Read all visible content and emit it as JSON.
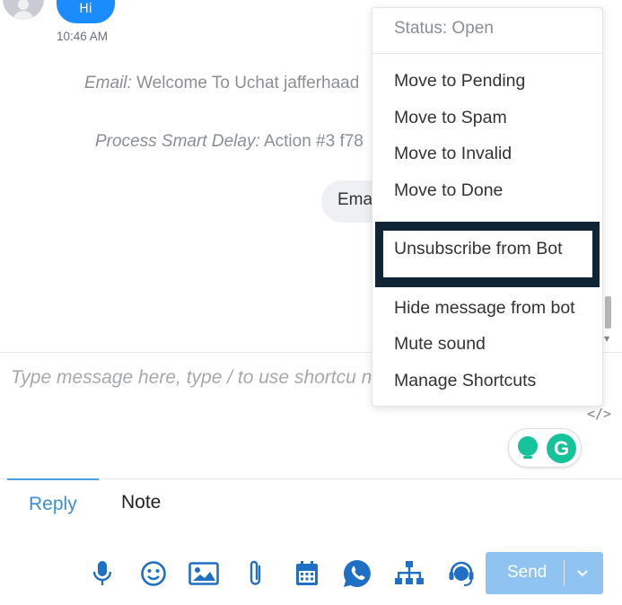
{
  "chat": {
    "incoming_bubble_text": "Hi",
    "incoming_time": "10:46 AM",
    "system_messages": [
      {
        "label": "Email:",
        "text": " Welcome To Uchat jafferhaad"
      },
      {
        "label": "Process Smart Delay:",
        "text": " Action #3 f78"
      }
    ],
    "outgoing_bubble_text": "Ema"
  },
  "composer": {
    "placeholder": "Type message here, type / to use shortcu new line",
    "code_toggle": "</>"
  },
  "grammarly": {
    "logo_letter": "G"
  },
  "tabs": {
    "reply": "Reply",
    "note": "Note"
  },
  "toolbar": {
    "icons": [
      "microphone-icon",
      "emoji-icon",
      "image-icon",
      "attachment-icon",
      "calendar-icon",
      "whatsapp-icon",
      "flow-icon",
      "support-agent-icon"
    ],
    "send_label": "Send",
    "send_dropdown": "⌄"
  },
  "menu": {
    "status": "Status: Open",
    "items": [
      "Move to Pending",
      "Move to Spam",
      "Move to Invalid",
      "Move to Done"
    ],
    "highlighted": "Unsubscribe from Bot",
    "items_after": [
      "Hide message from bot",
      "Mute sound",
      "Manage Shortcuts"
    ]
  },
  "colors": {
    "accent": "#1a8cff",
    "send_button": "#8fc3f2",
    "toolbar_icon": "#1f6fc5",
    "highlight_border": "#0f2435",
    "grammarly": "#15c39a"
  }
}
